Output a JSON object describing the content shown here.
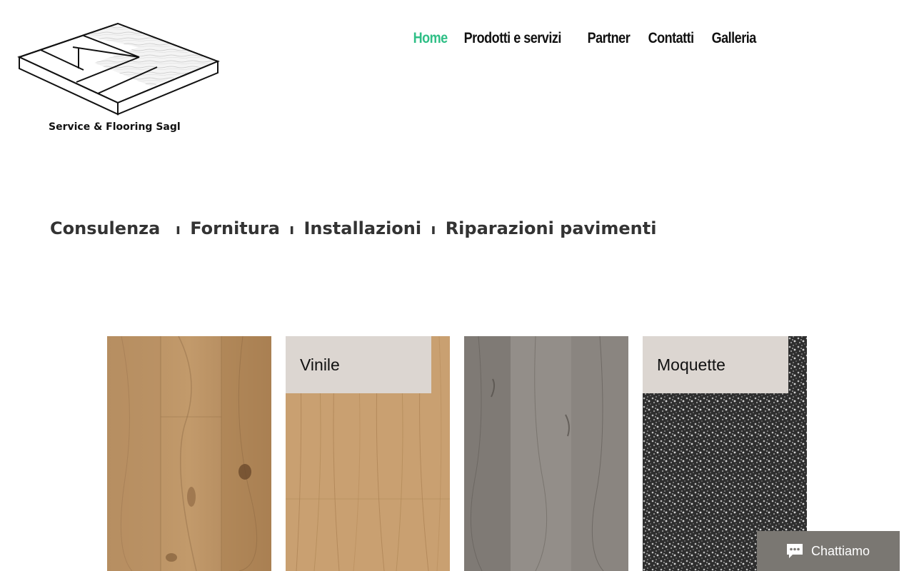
{
  "brand": {
    "name": "Service & Flooring Sagl"
  },
  "nav": {
    "items": [
      {
        "label": "Home",
        "active": true
      },
      {
        "label": "Prodotti e servizi",
        "active": false
      },
      {
        "label": "Partner",
        "active": false
      },
      {
        "label": "Contatti",
        "active": false
      },
      {
        "label": "Galleria",
        "active": false
      }
    ],
    "active_color": "#2fbf86"
  },
  "tagline": {
    "parts": [
      "Consulenza",
      "Fornitura",
      "Installazioni",
      "Riparazioni pavimenti"
    ],
    "separator": "ı"
  },
  "products": [
    {
      "label": "",
      "texture": "oak-knotty"
    },
    {
      "label": "Vinile",
      "texture": "oak-light"
    },
    {
      "label": "",
      "texture": "grey-wood"
    },
    {
      "label": "Moquette",
      "texture": "dark-carpet"
    }
  ],
  "chat": {
    "label": "Chattiamo",
    "icon": "chat-bubble-icon"
  },
  "colors": {
    "label_box": "#dcd6d1",
    "chat_bg": "#7a7772",
    "tagline": "#333333"
  }
}
